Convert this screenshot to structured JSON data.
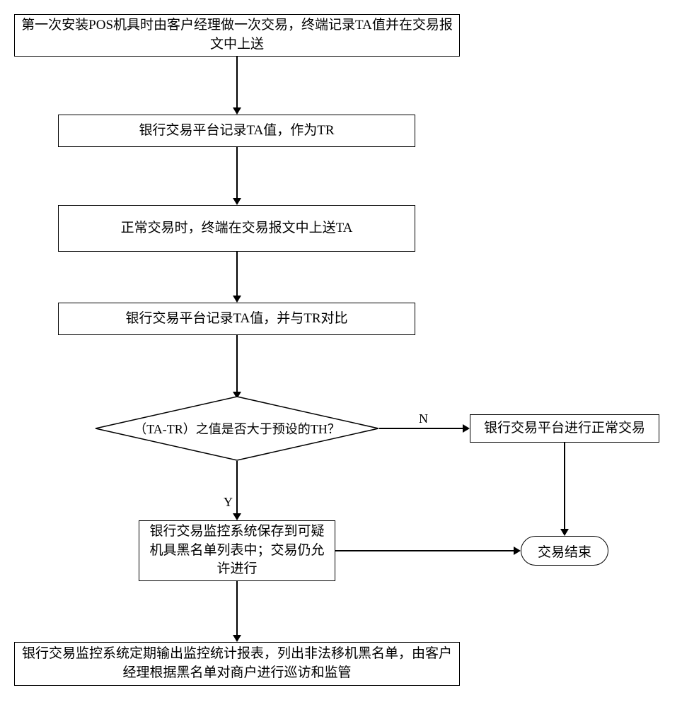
{
  "chart_data": {
    "type": "table",
    "description": "Flowchart of POS terminal transaction monitoring process",
    "nodes": [
      {
        "id": "n1",
        "shape": "rect",
        "text": "第一次安装POS机具时由客户经理做一次交易，终端记录TA值并在交易报文中上送"
      },
      {
        "id": "n2",
        "shape": "rect",
        "text": "银行交易平台记录TA值，作为TR"
      },
      {
        "id": "n3",
        "shape": "rect",
        "text": "正常交易时，终端在交易报文中上送TA"
      },
      {
        "id": "n4",
        "shape": "rect",
        "text": "银行交易平台记录TA值，并与TR对比"
      },
      {
        "id": "n5",
        "shape": "diamond",
        "text": "（TA-TR）之值是否大于预设的TH？"
      },
      {
        "id": "n6",
        "shape": "rect",
        "text": "银行交易平台进行正常交易"
      },
      {
        "id": "n7",
        "shape": "rect",
        "text": "银行交易监控系统保存到可疑机具黑名单列表中；交易仍允许进行"
      },
      {
        "id": "n8",
        "shape": "terminator",
        "text": "交易结束"
      },
      {
        "id": "n9",
        "shape": "rect",
        "text": "银行交易监控系统定期输出监控统计报表，列出非法移机黑名单，由客户经理根据黑名单对商户进行巡访和监管"
      }
    ],
    "edges": [
      {
        "from": "n1",
        "to": "n2",
        "label": ""
      },
      {
        "from": "n2",
        "to": "n3",
        "label": ""
      },
      {
        "from": "n3",
        "to": "n4",
        "label": ""
      },
      {
        "from": "n4",
        "to": "n5",
        "label": ""
      },
      {
        "from": "n5",
        "to": "n6",
        "label": "N"
      },
      {
        "from": "n5",
        "to": "n7",
        "label": "Y"
      },
      {
        "from": "n6",
        "to": "n8",
        "label": ""
      },
      {
        "from": "n7",
        "to": "n8",
        "label": ""
      },
      {
        "from": "n7",
        "to": "n9",
        "label": ""
      }
    ]
  },
  "labels": {
    "yes": "Y",
    "no": "N"
  }
}
